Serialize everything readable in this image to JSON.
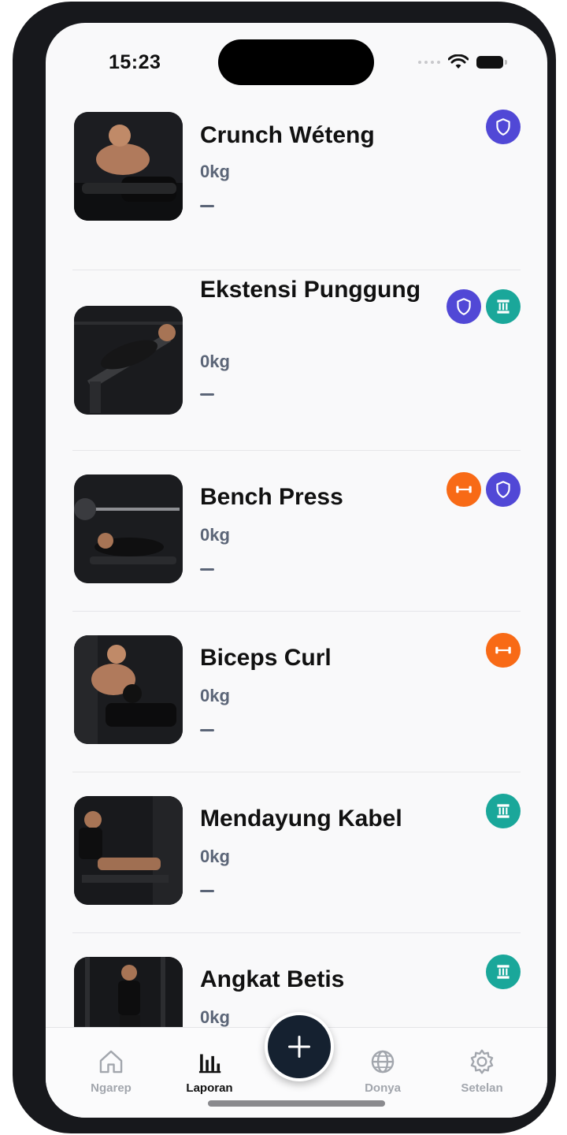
{
  "status": {
    "time": "15:23"
  },
  "exercises": [
    {
      "title": "Crunch Wéteng",
      "weight": "0kg",
      "badges": [
        "shield-icon"
      ]
    },
    {
      "title": "Ekstensi Punggung",
      "weight": "0kg",
      "badges": [
        "shield-icon",
        "pillar-icon"
      ]
    },
    {
      "title": "Bench Press",
      "weight": "0kg",
      "badges": [
        "dumbbell-icon",
        "shield-icon"
      ]
    },
    {
      "title": "Biceps Curl",
      "weight": "0kg",
      "badges": [
        "dumbbell-icon"
      ]
    },
    {
      "title": "Mendayung Kabel",
      "weight": "0kg",
      "badges": [
        "pillar-icon"
      ]
    },
    {
      "title": "Angkat Betis",
      "weight": "0kg",
      "badges": [
        "pillar-icon"
      ]
    }
  ],
  "colors": {
    "shield": "#5148d6",
    "pillar": "#1aa79a",
    "dumbbell": "#f86a16",
    "fab": "#152130"
  },
  "tabs": [
    {
      "label": "Ngarep",
      "icon": "home-icon"
    },
    {
      "label": "Laporan",
      "icon": "bar-chart-icon"
    },
    {
      "label": "Donya",
      "icon": "globe-icon"
    },
    {
      "label": "Setelan",
      "icon": "gear-icon"
    }
  ],
  "fab": {
    "icon": "plus-icon"
  }
}
